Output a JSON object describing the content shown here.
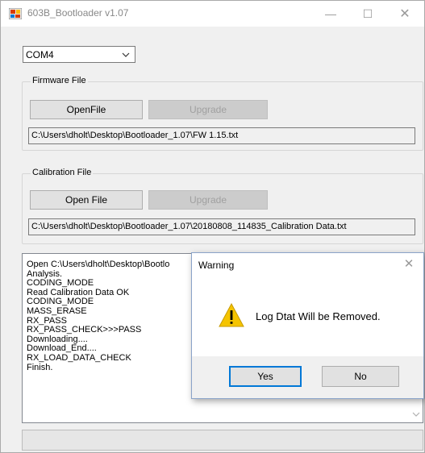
{
  "window": {
    "title": "603B_Bootloader v1.07",
    "controls": {
      "minimize": "—",
      "maximize": "☐",
      "close": "✕"
    }
  },
  "port": {
    "selected": "COM4"
  },
  "firmware": {
    "legend": "Firmware File",
    "open_label": "OpenFile",
    "upgrade_label": "Upgrade",
    "path": "C:\\Users\\dholt\\Desktop\\Bootloader_1.07\\FW 1.15.txt"
  },
  "calibration": {
    "legend": "Calibration File",
    "open_label": "Open File",
    "upgrade_label": "Upgrade",
    "path": "C:\\Users\\dholt\\Desktop\\Bootloader_1.07\\20180808_114835_Calibration Data.txt"
  },
  "log": {
    "lines": [
      "Open C:\\Users\\dholt\\Desktop\\Bootlo",
      "Analysis.",
      "CODING_MODE",
      "Read Calibration Data OK",
      "CODING_MODE",
      "MASS_ERASE",
      "RX_PASS",
      "RX_PASS_CHECK>>>PASS",
      "Downloading....",
      "Download_End....",
      "RX_LOAD_DATA_CHECK",
      "Finish."
    ]
  },
  "dialog": {
    "title": "Warning",
    "close": "✕",
    "message": "Log Dtat Will be Removed.",
    "yes_label": "Yes",
    "no_label": "No"
  },
  "colors": {
    "accent": "#0078d7",
    "warning_yellow": "#f5c400"
  }
}
